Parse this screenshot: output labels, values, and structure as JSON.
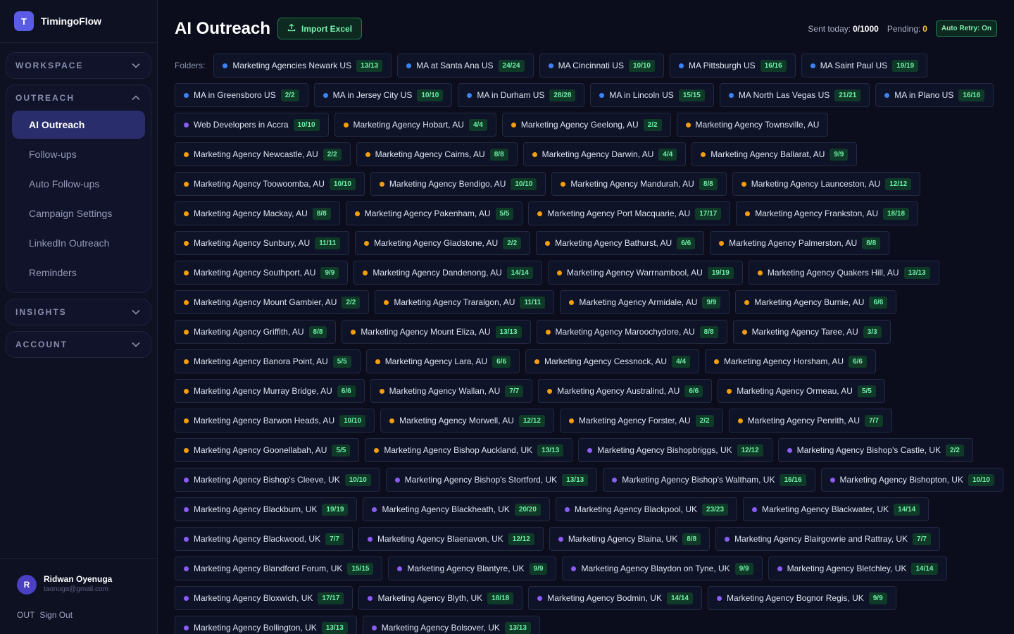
{
  "app": {
    "logo_letter": "T",
    "name": "TimingoFlow"
  },
  "sidebar": {
    "workspace": {
      "title": "WORKSPACE"
    },
    "outreach": {
      "title": "OUTREACH",
      "items": [
        {
          "label": "AI Outreach"
        },
        {
          "label": "Follow-ups"
        },
        {
          "label": "Auto Follow-ups"
        },
        {
          "label": "Campaign Settings"
        },
        {
          "label": "LinkedIn Outreach"
        },
        {
          "label": "Reminders"
        }
      ]
    },
    "insights": {
      "title": "INSIGHTS"
    },
    "account": {
      "title": "ACCOUNT"
    }
  },
  "user": {
    "initial": "R",
    "name": "Ridwan Oyenuga",
    "email": "taonuga@gmail.com",
    "signout_icon_text": "OUT",
    "signout_label": "Sign Out"
  },
  "header": {
    "title": "AI Outreach",
    "import_label": "Import Excel",
    "sent_label": "Sent today:",
    "sent_value": "0/1000",
    "pending_label": "Pending:",
    "pending_value": "0",
    "retry_label": "Auto Retry: On"
  },
  "colors": {
    "blue": "#3b82f6",
    "orange": "#f59e0b",
    "purple": "#8b5cf6",
    "accent": "#5b5ce6",
    "success": "#6ef0a8"
  },
  "folders_label": "Folders:",
  "folders": [
    {
      "name": "Marketing Agencies Newark US",
      "count": "13/13",
      "color": "blue"
    },
    {
      "name": "MA at Santa Ana US",
      "count": "24/24",
      "color": "blue"
    },
    {
      "name": "MA Cincinnati US",
      "count": "10/10",
      "color": "blue"
    },
    {
      "name": "MA Pittsburgh US",
      "count": "16/16",
      "color": "blue"
    },
    {
      "name": "MA Saint Paul US",
      "count": "19/19",
      "color": "blue"
    },
    {
      "name": "MA in Greensboro US",
      "count": "2/2",
      "color": "blue"
    },
    {
      "name": "MA in Jersey City US",
      "count": "10/10",
      "color": "blue"
    },
    {
      "name": "MA in Durham US",
      "count": "28/28",
      "color": "blue"
    },
    {
      "name": "MA in Lincoln US",
      "count": "15/15",
      "color": "blue"
    },
    {
      "name": "MA North Las Vegas US",
      "count": "21/21",
      "color": "blue"
    },
    {
      "name": "MA in Plano US",
      "count": "16/16",
      "color": "blue"
    },
    {
      "name": "Web Developers in Accra",
      "count": "10/10",
      "color": "purple"
    },
    {
      "name": "Marketing Agency Hobart, AU",
      "count": "4/4",
      "color": "orange"
    },
    {
      "name": "Marketing Agency Geelong, AU",
      "count": "2/2",
      "color": "orange"
    },
    {
      "name": "Marketing Agency Townsville, AU",
      "count": "",
      "color": "orange"
    },
    {
      "name": "Marketing Agency Newcastle, AU",
      "count": "2/2",
      "color": "orange"
    },
    {
      "name": "Marketing Agency Cairns, AU",
      "count": "8/8",
      "color": "orange"
    },
    {
      "name": "Marketing Agency Darwin, AU",
      "count": "4/4",
      "color": "orange"
    },
    {
      "name": "Marketing Agency Ballarat, AU",
      "count": "9/9",
      "color": "orange"
    },
    {
      "name": "Marketing Agency Toowoomba, AU",
      "count": "10/10",
      "color": "orange"
    },
    {
      "name": "Marketing Agency Bendigo, AU",
      "count": "10/10",
      "color": "orange"
    },
    {
      "name": "Marketing Agency Mandurah, AU",
      "count": "8/8",
      "color": "orange"
    },
    {
      "name": "Marketing Agency Launceston, AU",
      "count": "12/12",
      "color": "orange"
    },
    {
      "name": "Marketing Agency Mackay, AU",
      "count": "8/8",
      "color": "orange"
    },
    {
      "name": "Marketing Agency Pakenham, AU",
      "count": "5/5",
      "color": "orange"
    },
    {
      "name": "Marketing Agency Port Macquarie, AU",
      "count": "17/17",
      "color": "orange"
    },
    {
      "name": "Marketing Agency Frankston, AU",
      "count": "18/18",
      "color": "orange"
    },
    {
      "name": "Marketing Agency Sunbury, AU",
      "count": "11/11",
      "color": "orange"
    },
    {
      "name": "Marketing Agency Gladstone, AU",
      "count": "2/2",
      "color": "orange"
    },
    {
      "name": "Marketing Agency Bathurst, AU",
      "count": "6/6",
      "color": "orange"
    },
    {
      "name": "Marketing Agency Palmerston, AU",
      "count": "8/8",
      "color": "orange"
    },
    {
      "name": "Marketing Agency Southport, AU",
      "count": "9/9",
      "color": "orange"
    },
    {
      "name": "Marketing Agency Dandenong, AU",
      "count": "14/14",
      "color": "orange"
    },
    {
      "name": "Marketing Agency Warrnambool, AU",
      "count": "19/19",
      "color": "orange"
    },
    {
      "name": "Marketing Agency Quakers Hill, AU",
      "count": "13/13",
      "color": "orange"
    },
    {
      "name": "Marketing Agency Mount Gambier, AU",
      "count": "2/2",
      "color": "orange"
    },
    {
      "name": "Marketing Agency Traralgon, AU",
      "count": "11/11",
      "color": "orange"
    },
    {
      "name": "Marketing Agency Armidale, AU",
      "count": "9/9",
      "color": "orange"
    },
    {
      "name": "Marketing Agency Burnie, AU",
      "count": "6/6",
      "color": "orange"
    },
    {
      "name": "Marketing Agency Griffith, AU",
      "count": "8/8",
      "color": "orange"
    },
    {
      "name": "Marketing Agency Mount Eliza, AU",
      "count": "13/13",
      "color": "orange"
    },
    {
      "name": "Marketing Agency Maroochydore, AU",
      "count": "8/8",
      "color": "orange"
    },
    {
      "name": "Marketing Agency Taree, AU",
      "count": "3/3",
      "color": "orange"
    },
    {
      "name": "Marketing Agency Banora Point, AU",
      "count": "5/5",
      "color": "orange"
    },
    {
      "name": "Marketing Agency Lara, AU",
      "count": "6/6",
      "color": "orange"
    },
    {
      "name": "Marketing Agency Cessnock, AU",
      "count": "4/4",
      "color": "orange"
    },
    {
      "name": "Marketing Agency Horsham, AU",
      "count": "6/6",
      "color": "orange"
    },
    {
      "name": "Marketing Agency Murray Bridge, AU",
      "count": "6/6",
      "color": "orange"
    },
    {
      "name": "Marketing Agency Wallan, AU",
      "count": "7/7",
      "color": "orange"
    },
    {
      "name": "Marketing Agency Australind, AU",
      "count": "6/6",
      "color": "orange"
    },
    {
      "name": "Marketing Agency Ormeau, AU",
      "count": "5/5",
      "color": "orange"
    },
    {
      "name": "Marketing Agency Barwon Heads, AU",
      "count": "10/10",
      "color": "orange"
    },
    {
      "name": "Marketing Agency Morwell, AU",
      "count": "12/12",
      "color": "orange"
    },
    {
      "name": "Marketing Agency Forster, AU",
      "count": "2/2",
      "color": "orange"
    },
    {
      "name": "Marketing Agency Penrith, AU",
      "count": "7/7",
      "color": "orange"
    },
    {
      "name": "Marketing Agency Goonellabah, AU",
      "count": "5/5",
      "color": "orange"
    },
    {
      "name": "Marketing Agency Bishop Auckland, UK",
      "count": "13/13",
      "color": "orange"
    },
    {
      "name": "Marketing Agency Bishopbriggs, UK",
      "count": "12/12",
      "color": "purple"
    },
    {
      "name": "Marketing Agency Bishop's Castle, UK",
      "count": "2/2",
      "color": "purple"
    },
    {
      "name": "Marketing Agency Bishop's Cleeve, UK",
      "count": "10/10",
      "color": "purple"
    },
    {
      "name": "Marketing Agency Bishop's Stortford, UK",
      "count": "13/13",
      "color": "purple"
    },
    {
      "name": "Marketing Agency Bishop's Waltham, UK",
      "count": "16/16",
      "color": "purple"
    },
    {
      "name": "Marketing Agency Bishopton, UK",
      "count": "10/10",
      "color": "purple"
    },
    {
      "name": "Marketing Agency Blackburn, UK",
      "count": "19/19",
      "color": "purple"
    },
    {
      "name": "Marketing Agency Blackheath, UK",
      "count": "20/20",
      "color": "purple"
    },
    {
      "name": "Marketing Agency Blackpool, UK",
      "count": "23/23",
      "color": "purple"
    },
    {
      "name": "Marketing Agency Blackwater, UK",
      "count": "14/14",
      "color": "purple"
    },
    {
      "name": "Marketing Agency Blackwood, UK",
      "count": "7/7",
      "color": "purple"
    },
    {
      "name": "Marketing Agency Blaenavon, UK",
      "count": "12/12",
      "color": "purple"
    },
    {
      "name": "Marketing Agency Blaina, UK",
      "count": "8/8",
      "color": "purple"
    },
    {
      "name": "Marketing Agency Blairgowrie and Rattray, UK",
      "count": "7/7",
      "color": "purple"
    },
    {
      "name": "Marketing Agency Blandford Forum, UK",
      "count": "15/15",
      "color": "purple"
    },
    {
      "name": "Marketing Agency Blantyre, UK",
      "count": "9/9",
      "color": "purple"
    },
    {
      "name": "Marketing Agency Blaydon on Tyne, UK",
      "count": "9/9",
      "color": "purple"
    },
    {
      "name": "Marketing Agency Bletchley, UK",
      "count": "14/14",
      "color": "purple"
    },
    {
      "name": "Marketing Agency Bloxwich, UK",
      "count": "17/17",
      "color": "purple"
    },
    {
      "name": "Marketing Agency Blyth, UK",
      "count": "18/18",
      "color": "purple"
    },
    {
      "name": "Marketing Agency Bodmin, UK",
      "count": "14/14",
      "color": "purple"
    },
    {
      "name": "Marketing Agency Bognor Regis, UK",
      "count": "9/9",
      "color": "purple"
    },
    {
      "name": "Marketing Agency Bollington, UK",
      "count": "13/13",
      "color": "purple"
    },
    {
      "name": "Marketing Agency Bolsover, UK",
      "count": "13/13",
      "color": "purple"
    }
  ]
}
